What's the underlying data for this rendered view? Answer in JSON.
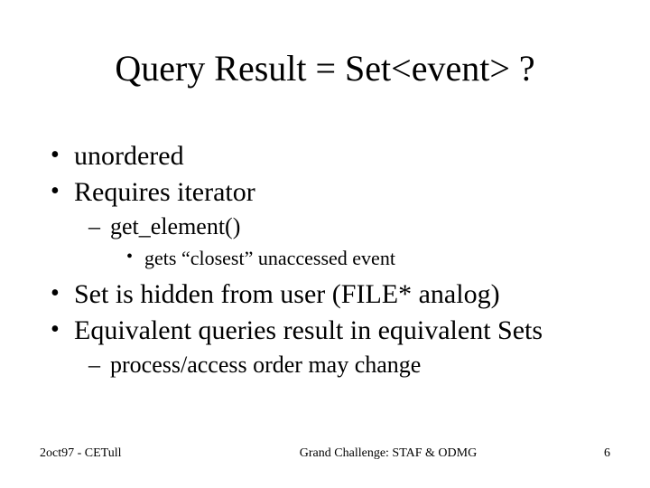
{
  "title": "Query Result = Set<event> ?",
  "bullets": {
    "b1": "unordered",
    "b2": "Requires iterator",
    "b2_1": "get_element()",
    "b2_1_1": "gets “closest” unaccessed event",
    "b3": "Set is hidden from user (FILE* analog)",
    "b4": "Equivalent queries result in equivalent Sets",
    "b4_1": "process/access order may change"
  },
  "footer": {
    "left": "2oct97 - CETull",
    "center": "Grand Challenge: STAF & ODMG",
    "right": "6"
  }
}
